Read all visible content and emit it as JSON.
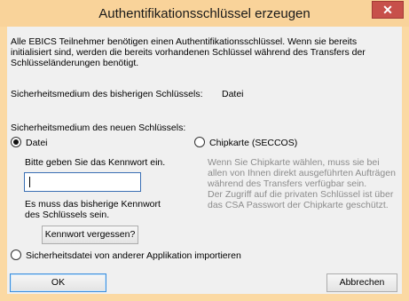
{
  "window": {
    "title": "Authentifikationsschlüssel erzeugen",
    "close_glyph": "✕"
  },
  "intro": {
    "text": "Alle EBICS Teilnehmer benötigen einen Authentifikationsschlüssel. Wenn sie bereits\ninitialisiert sind, werden die bereits vorhandenen Schlüssel während des Transfers der\nSchlüsseländerungen benötigt."
  },
  "previous": {
    "label": "Sicherheitsmedium des bisherigen Schlüssels:",
    "value": "Datei"
  },
  "new_medium": {
    "label": "Sicherheitsmedium des neuen Schlüssels:",
    "options": [
      {
        "label": "Datei",
        "selected": true
      },
      {
        "label": "Chipkarte (SECCOS)",
        "selected": false
      },
      {
        "label": "Sicherheitsdatei von anderer Applikation importieren",
        "selected": false
      }
    ]
  },
  "datei": {
    "prompt": "Bitte geben Sie das Kennwort ein.",
    "password_value": "",
    "hint": "Es muss das bisherige Kennwort\ndes Schlüssels sein.",
    "forgot_button": "Kennwort vergessen?"
  },
  "chipkarte": {
    "info": "Wenn Sie Chipkarte wählen, muss sie bei\nallen von Ihnen direkt ausgeführten Aufträgen\nwährend des Transfers verfügbar sein.\nDer Zugriff auf die privaten Schlüssel ist über\ndas CSA Passwort der Chipkarte geschützt."
  },
  "footer": {
    "ok": "OK",
    "cancel": "Abbrechen"
  },
  "colors": {
    "titlebar": "#f9d39a",
    "close": "#c7504a",
    "client": "#f0f0f0",
    "muted_text": "#8c8c8c"
  }
}
